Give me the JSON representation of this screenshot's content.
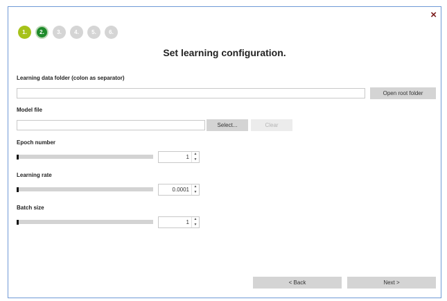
{
  "window": {
    "close_icon": "×"
  },
  "steps": [
    {
      "label": "1.",
      "state": "done"
    },
    {
      "label": "2.",
      "state": "current"
    },
    {
      "label": "3.",
      "state": "todo"
    },
    {
      "label": "4.",
      "state": "todo"
    },
    {
      "label": "5.",
      "state": "todo"
    },
    {
      "label": "6.",
      "state": "todo"
    }
  ],
  "title": "Set learning configuration.",
  "data_folder": {
    "label": "Learning data folder (colon as separator)",
    "value": "",
    "button": "Open root folder"
  },
  "model_file": {
    "label": "Model file",
    "value": "",
    "select_button": "Select...",
    "clear_button": "Clear"
  },
  "epoch": {
    "label": "Epoch number",
    "value": "1",
    "slider_level": 0
  },
  "learning_rate": {
    "label": "Learning rate",
    "value": "0.0001",
    "slider_level": 0
  },
  "batch_size": {
    "label": "Batch size",
    "value": "1",
    "slider_level": 0
  },
  "footer": {
    "back_button": "< Back",
    "next_button": "Next >"
  },
  "colors": {
    "step_done": "#a6c21a",
    "step_current": "#1d8a2a",
    "step_todo": "#d5d5d5",
    "window_border": "#6f99d6"
  },
  "icons": {
    "spin_up": "spin-up-icon",
    "spin_down": "spin-down-icon",
    "close": "close-icon"
  }
}
